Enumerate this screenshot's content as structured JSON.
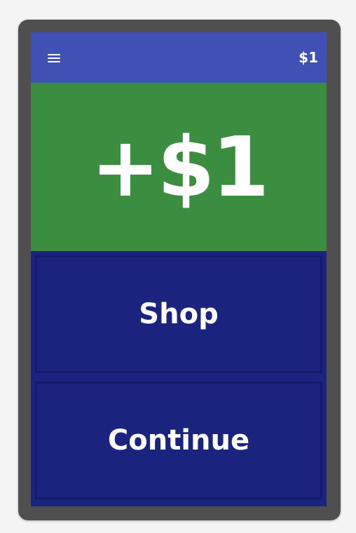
{
  "app_bar": {
    "menu_icon": "hamburger-menu-icon",
    "balance": "$1",
    "color": "#3f51b5"
  },
  "reward": {
    "amount_text": "+$1",
    "color": "#3b8e3f"
  },
  "actions": {
    "shop_label": "Shop",
    "continue_label": "Continue",
    "color": "#1a237e"
  }
}
